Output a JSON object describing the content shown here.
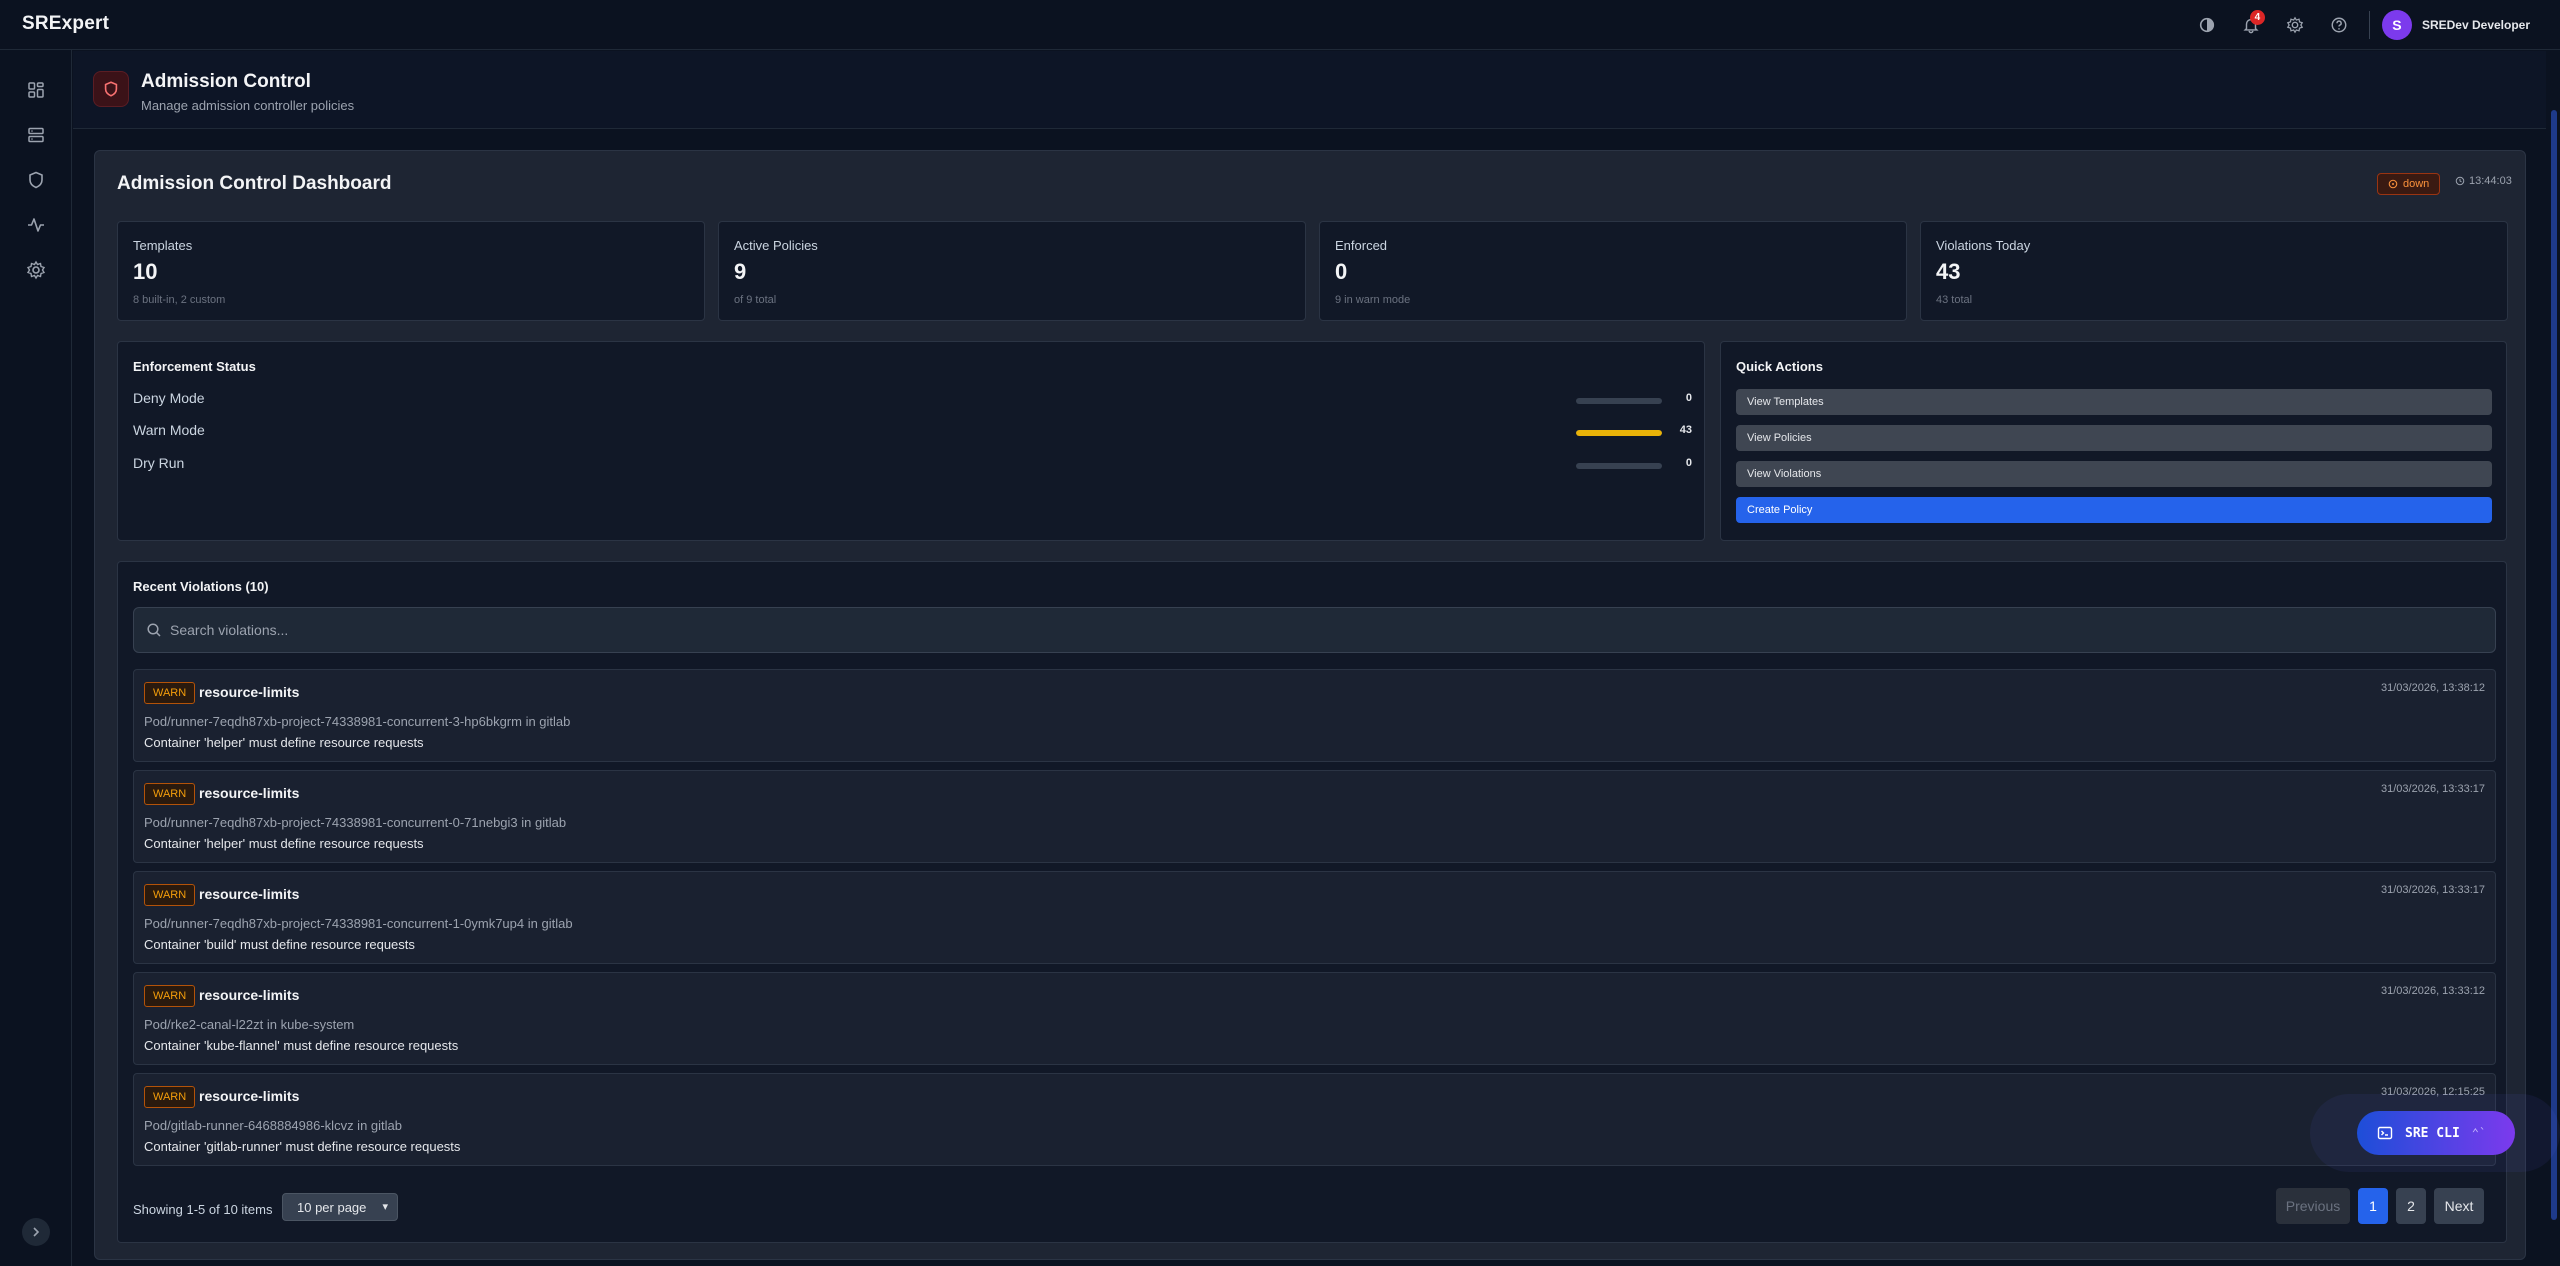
{
  "app": {
    "brand": "SRExpert"
  },
  "topbar": {
    "notifications_count": "4",
    "user_initial": "S",
    "user_name": "SREDev Developer"
  },
  "sidebar": {
    "items": [
      "dashboard",
      "servers",
      "shield",
      "activity",
      "settings"
    ]
  },
  "page": {
    "title": "Admission Control",
    "subtitle": "Manage admission controller policies"
  },
  "dashboard": {
    "title": "Admission Control Dashboard",
    "status": "down",
    "time": "13:44:03",
    "stats": [
      {
        "label": "Templates",
        "value": "10",
        "sub": "8 built-in, 2 custom"
      },
      {
        "label": "Active Policies",
        "value": "9",
        "sub": "of 9 total"
      },
      {
        "label": "Enforced",
        "value": "0",
        "sub": "9 in warn mode"
      },
      {
        "label": "Violations Today",
        "value": "43",
        "sub": "43 total"
      }
    ]
  },
  "enforcement": {
    "title": "Enforcement Status",
    "rows": [
      {
        "label": "Deny Mode",
        "count": "0",
        "fraction": 0
      },
      {
        "label": "Warn Mode",
        "count": "43",
        "fraction": 1
      },
      {
        "label": "Dry Run",
        "count": "0",
        "fraction": 0
      }
    ],
    "accent": "#eab308"
  },
  "quick_actions": {
    "title": "Quick Actions",
    "buttons": [
      "View Templates",
      "View Policies",
      "View Violations",
      "Create Policy"
    ]
  },
  "violations": {
    "title": "Recent Violations (10)",
    "search_placeholder": "Search violations...",
    "items": [
      {
        "severity": "WARN",
        "policy": "resource-limits",
        "resource": "Pod/runner-7eqdh87xb-project-74338981-concurrent-3-hp6bkgrm in gitlab",
        "message": "Container 'helper' must define resource requests",
        "time": "31/03/2026, 13:38:12"
      },
      {
        "severity": "WARN",
        "policy": "resource-limits",
        "resource": "Pod/runner-7eqdh87xb-project-74338981-concurrent-0-71nebgi3 in gitlab",
        "message": "Container 'helper' must define resource requests",
        "time": "31/03/2026, 13:33:17"
      },
      {
        "severity": "WARN",
        "policy": "resource-limits",
        "resource": "Pod/runner-7eqdh87xb-project-74338981-concurrent-1-0ymk7up4 in gitlab",
        "message": "Container 'build' must define resource requests",
        "time": "31/03/2026, 13:33:17"
      },
      {
        "severity": "WARN",
        "policy": "resource-limits",
        "resource": "Pod/rke2-canal-l22zt in kube-system",
        "message": "Container 'kube-flannel' must define resource requests",
        "time": "31/03/2026, 13:33:12"
      },
      {
        "severity": "WARN",
        "policy": "resource-limits",
        "resource": "Pod/gitlab-runner-6468884986-klcvz in gitlab",
        "message": "Container 'gitlab-runner' must define resource requests",
        "time": "31/03/2026, 12:15:25"
      }
    ],
    "showing": "Showing 1-5 of 10 items",
    "per_page": "10 per page",
    "pagination": {
      "previous": "Previous",
      "pages": [
        "1",
        "2"
      ],
      "next": "Next"
    }
  },
  "sre_cli": {
    "label": "SRE CLI",
    "shortcut": "⌃`"
  }
}
